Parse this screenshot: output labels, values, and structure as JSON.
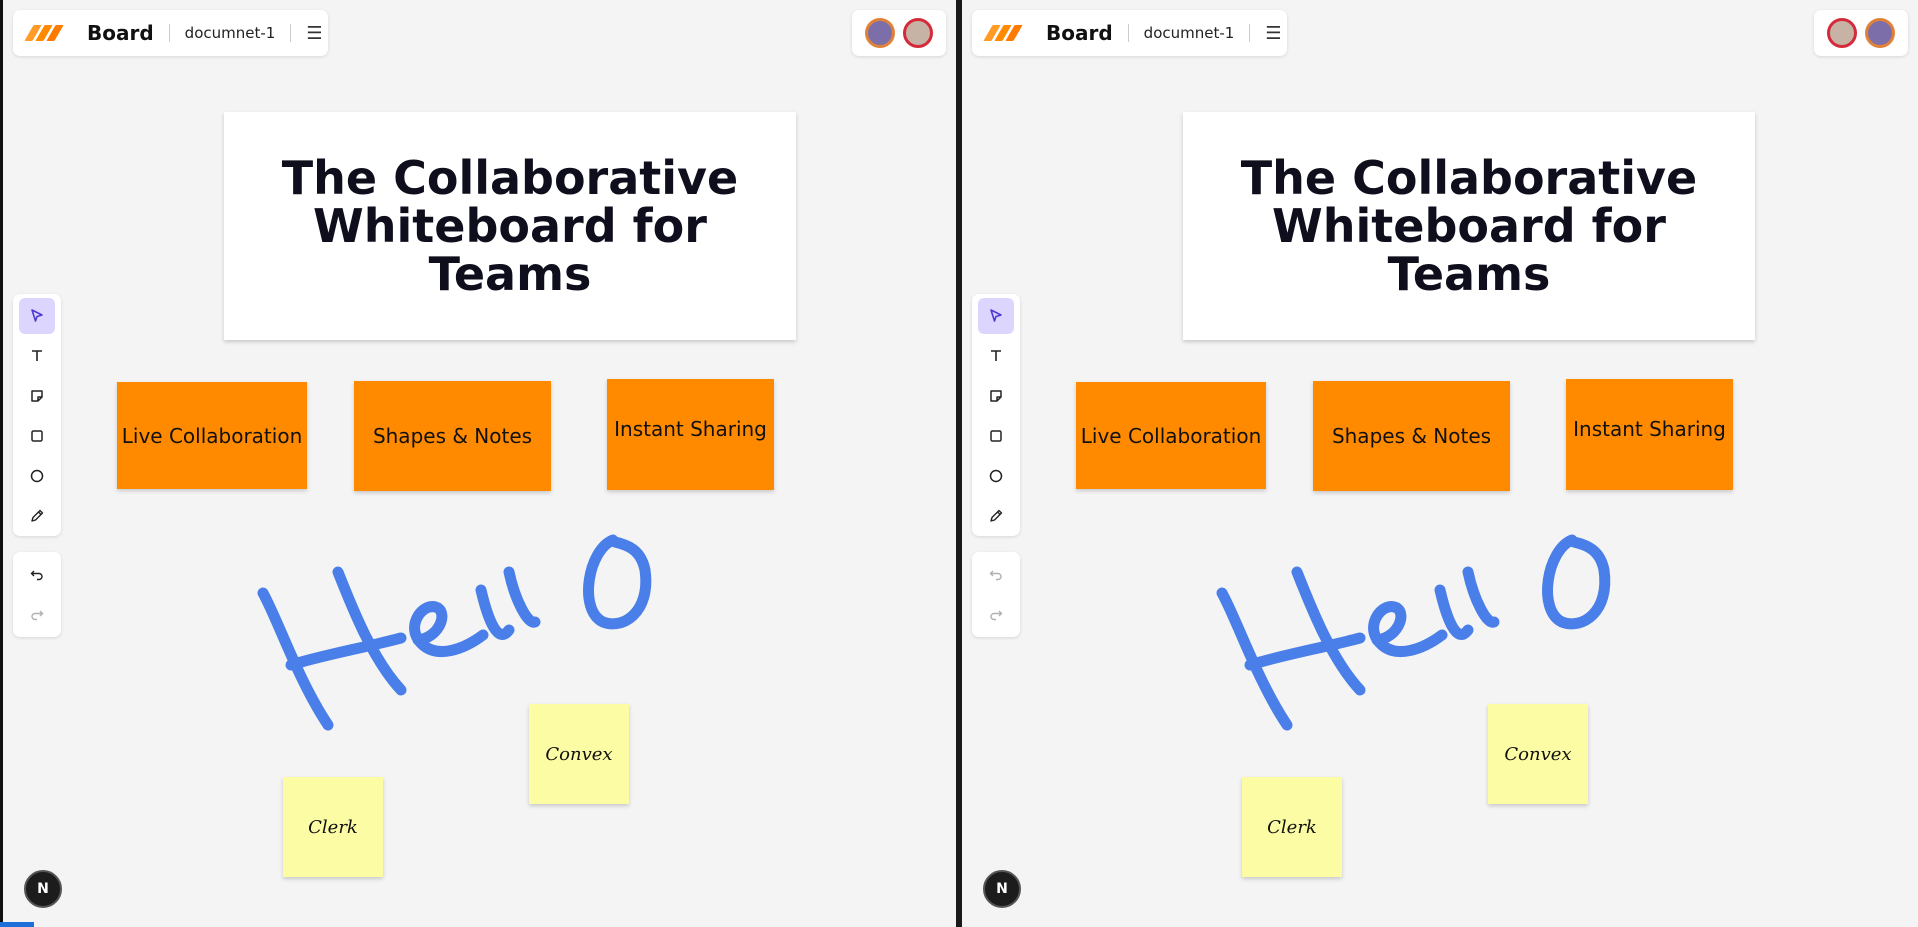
{
  "app": {
    "brand": "Board",
    "document_name": "documnet-1",
    "menu_icon": "hamburger-icon"
  },
  "toolbar": {
    "tools": [
      {
        "name": "select",
        "icon": "cursor-icon",
        "active": true
      },
      {
        "name": "text",
        "icon": "text-icon",
        "active": false
      },
      {
        "name": "sticky-note",
        "icon": "note-icon",
        "active": false
      },
      {
        "name": "rectangle",
        "icon": "square-icon",
        "active": false
      },
      {
        "name": "ellipse",
        "icon": "circle-icon",
        "active": false
      },
      {
        "name": "pen",
        "icon": "pencil-icon",
        "active": false
      }
    ],
    "history": [
      {
        "name": "undo",
        "icon": "undo-icon"
      },
      {
        "name": "redo",
        "icon": "redo-icon"
      }
    ]
  },
  "canvas": {
    "title_card": "The Collaborative\nWhiteboard for Teams",
    "feature_boxes": [
      "Live Collaboration",
      "Shapes & Notes",
      "Instant Sharing"
    ],
    "sticky_notes": [
      "Convex",
      "Clerk"
    ],
    "drawing": "Hello"
  },
  "badge": "N",
  "colors": {
    "accent_orange": "#ff8a00",
    "sticky_yellow": "#fbfca3",
    "ink_blue": "#4a7ee8",
    "active_tool_bg": "#dcd6ff"
  }
}
